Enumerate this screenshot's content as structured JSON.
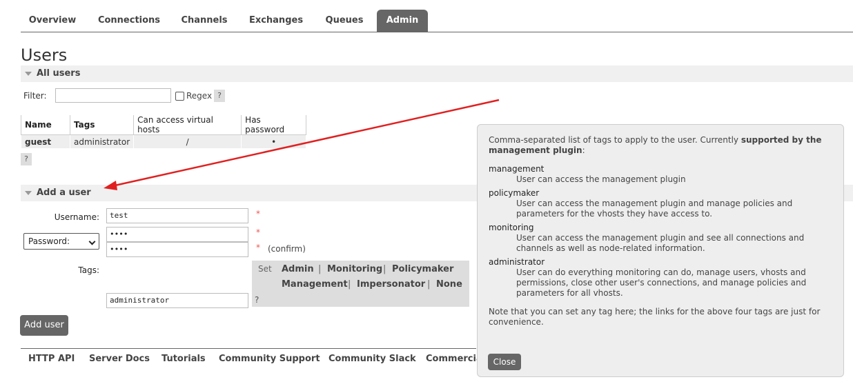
{
  "nav": {
    "tabs": [
      {
        "label": "Overview"
      },
      {
        "label": "Connections"
      },
      {
        "label": "Channels"
      },
      {
        "label": "Exchanges"
      },
      {
        "label": "Queues"
      },
      {
        "label": "Admin",
        "active": true
      }
    ]
  },
  "page": {
    "title": "Users"
  },
  "all_users": {
    "section_title": "All users",
    "filter_label": "Filter:",
    "filter_value": "",
    "regex_label": "Regex",
    "help": "?",
    "table": {
      "columns": [
        "Name",
        "Tags",
        "Can access virtual hosts",
        "Has password"
      ],
      "rows": [
        {
          "name": "guest",
          "tags": "administrator",
          "vhosts": "/",
          "has_password": "•"
        }
      ]
    },
    "table_help": "?"
  },
  "add_user": {
    "section_title": "Add a user",
    "username_label": "Username:",
    "username_value": "test",
    "password_select": "Password:",
    "password_value": "••••",
    "password_confirm_value": "••••",
    "required_mark": "*",
    "confirm_label": "(confirm)",
    "tags_label": "Tags:",
    "tags_value": "administrator",
    "tags_help": "?",
    "tag_set_label": "Set",
    "tag_links": [
      "Admin",
      "Monitoring",
      "Policymaker",
      "Management",
      "Impersonator",
      "None"
    ],
    "tag_sep": "|",
    "submit_label": "Add user"
  },
  "footer": {
    "links": [
      "HTTP API",
      "Server Docs",
      "Tutorials",
      "Community Support",
      "Community Slack",
      "Commercia"
    ]
  },
  "help_popup": {
    "intro_prefix": "Comma-separated list of tags to apply to the user. Currently ",
    "intro_bold": "supported by the management plugin",
    "intro_suffix": ":",
    "tags": [
      {
        "name": "management",
        "desc": "User can access the management plugin"
      },
      {
        "name": "policymaker",
        "desc": "User can access the management plugin and manage policies and parameters for the vhosts they have access to."
      },
      {
        "name": "monitoring",
        "desc": "User can access the management plugin and see all connections and channels as well as node-related information."
      },
      {
        "name": "administrator",
        "desc": "User can do everything monitoring can do, manage users, vhosts and permissions, close other user's connections, and manage policies and parameters for all vhosts."
      }
    ],
    "note": "Note that you can set any tag here; the links for the above four tags are just for convenience.",
    "close_label": "Close"
  },
  "colors": {
    "annotation_arrow": "#e02020",
    "nav_active": "#666666"
  }
}
